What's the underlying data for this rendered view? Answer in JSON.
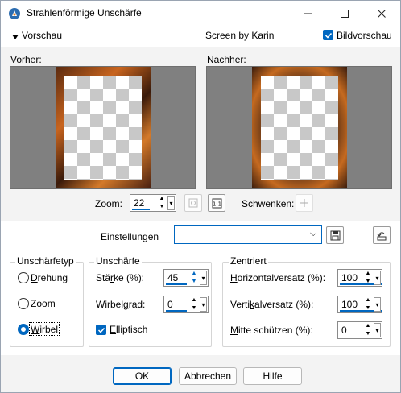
{
  "window": {
    "title": "Strahlenförmige Unschärfe",
    "minimize_icon": "minimize-icon",
    "maximize_icon": "maximize-icon",
    "close_icon": "close-icon"
  },
  "preview_bar": {
    "toggle_label": "Vorschau",
    "credit": "Screen by Karin",
    "live_preview_label": "Bildvorschau",
    "live_preview_checked": true
  },
  "previews": {
    "before_label": "Vorher:",
    "after_label": "Nachher:"
  },
  "zoom": {
    "label": "Zoom:",
    "value": "22",
    "pan_label": "Schwenken:"
  },
  "settings": {
    "label": "Einstellungen",
    "value": ""
  },
  "blur_type": {
    "title": "Unschärfetyp",
    "options": [
      {
        "prefix": "",
        "mnemonic": "D",
        "rest": "rehung",
        "selected": false
      },
      {
        "prefix": "",
        "mnemonic": "Z",
        "rest": "oom",
        "selected": false
      },
      {
        "prefix": "",
        "mnemonic": "W",
        "rest": "irbel",
        "selected": true
      }
    ]
  },
  "blur": {
    "title": "Unschärfe",
    "strength_label_pre": "Stä",
    "strength_label_mn": "r",
    "strength_label_post": "ke (%):",
    "strength_value": "45",
    "twirl_label_pre": "Wirbel",
    "twirl_label_mn": "g",
    "twirl_label_post": "rad:",
    "twirl_value": "0",
    "elliptical_label_pre": "",
    "elliptical_label_mn": "E",
    "elliptical_label_post": "lliptisch",
    "elliptical_checked": true
  },
  "centered": {
    "title": "Zentriert",
    "h_offset_pre": "",
    "h_offset_mn": "H",
    "h_offset_post": "orizontalversatz (%):",
    "h_offset_value": "100",
    "v_offset_pre": "Verti",
    "v_offset_mn": "k",
    "v_offset_post": "alversatz (%):",
    "v_offset_value": "100",
    "protect_pre": "",
    "protect_mn": "M",
    "protect_post": "itte schützen (%):",
    "protect_value": "0"
  },
  "buttons": {
    "ok": "OK",
    "cancel": "Abbrechen",
    "help": "Hilfe"
  },
  "colors": {
    "accent": "#0067c0",
    "pane_bg": "#808080"
  }
}
